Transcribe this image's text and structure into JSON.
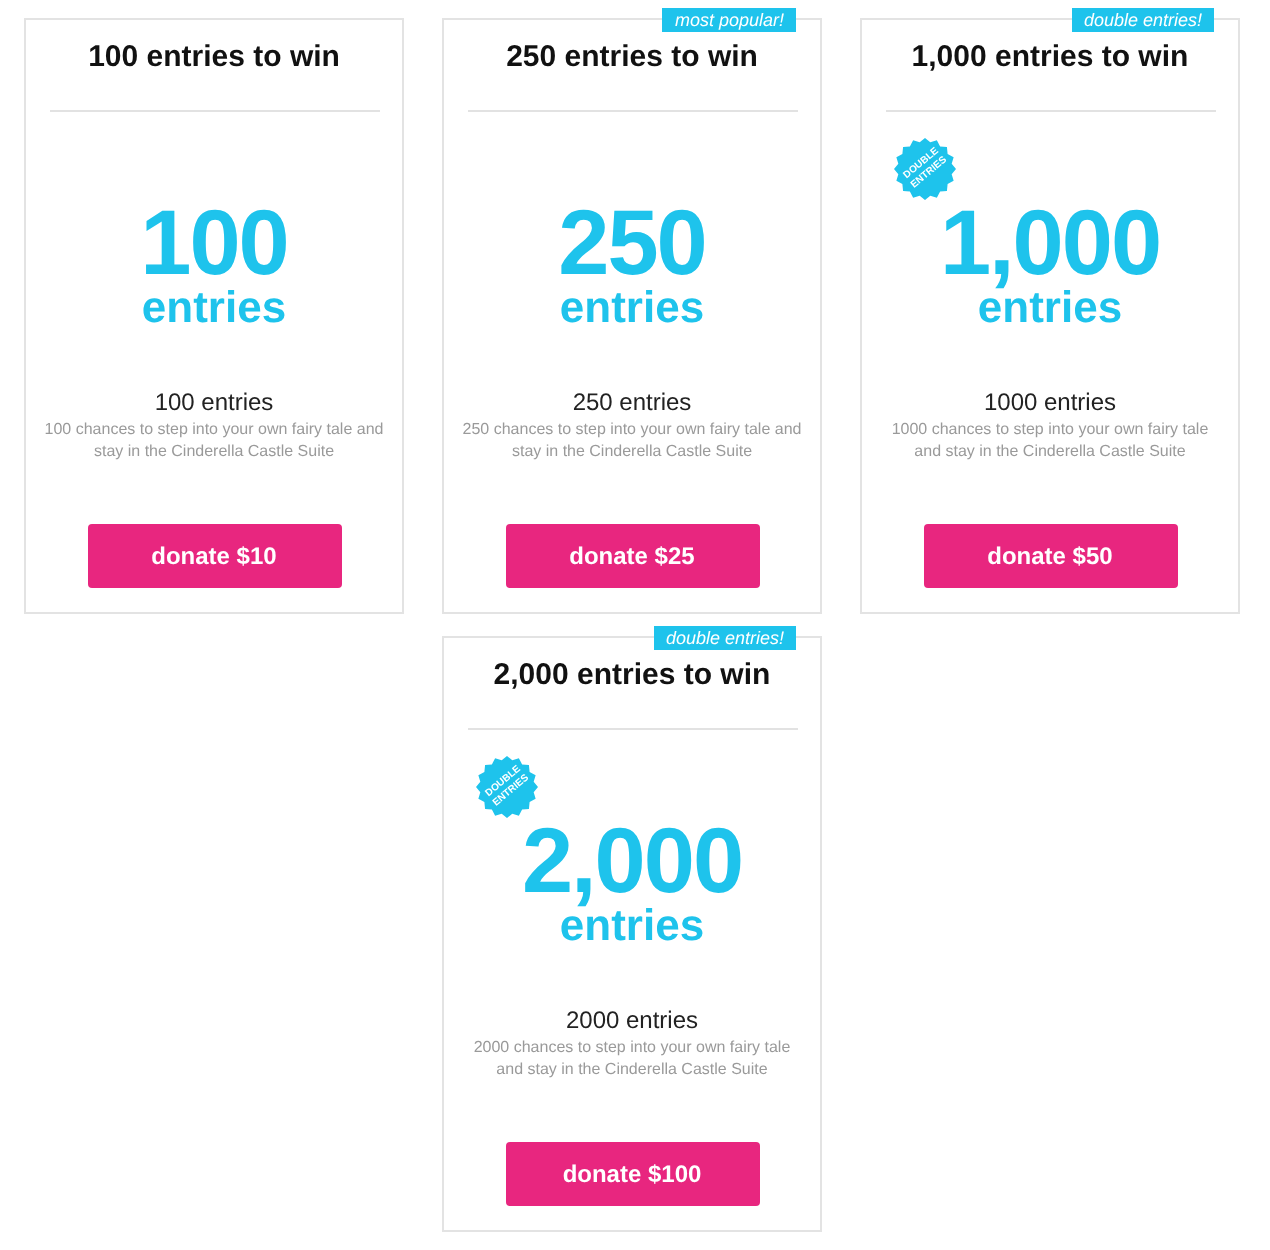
{
  "cards": [
    {
      "title": "100 entries to win",
      "count": "100",
      "unit": "entries",
      "subtitle": "100 entries",
      "description": "100 chances to step into your own fairy tale and stay in the Cinderella Castle Suite",
      "button": "donate $10"
    },
    {
      "title": "250 entries to win",
      "ribbon": "most popular!",
      "count": "250",
      "unit": "entries",
      "subtitle": "250 entries",
      "description": "250 chances to step into your own fairy tale and stay in the Cinderella Castle Suite",
      "button": "donate $25"
    },
    {
      "title": "1,000 entries to win",
      "ribbon": "double entries!",
      "burst": "DOUBLE ENTRIES",
      "count": "1,000",
      "unit": "entries",
      "subtitle": "1000 entries",
      "description": "1000 chances to step into your own fairy tale and stay in the Cinderella Castle Suite",
      "button": "donate $50"
    },
    {
      "title": "2,000 entries to win",
      "ribbon": "double entries!",
      "burst": "DOUBLE ENTRIES",
      "count": "2,000",
      "unit": "entries",
      "subtitle": "2000 entries",
      "description": "2000 chances to step into your own fairy tale and stay in the Cinderella Castle Suite",
      "button": "donate $100"
    }
  ]
}
